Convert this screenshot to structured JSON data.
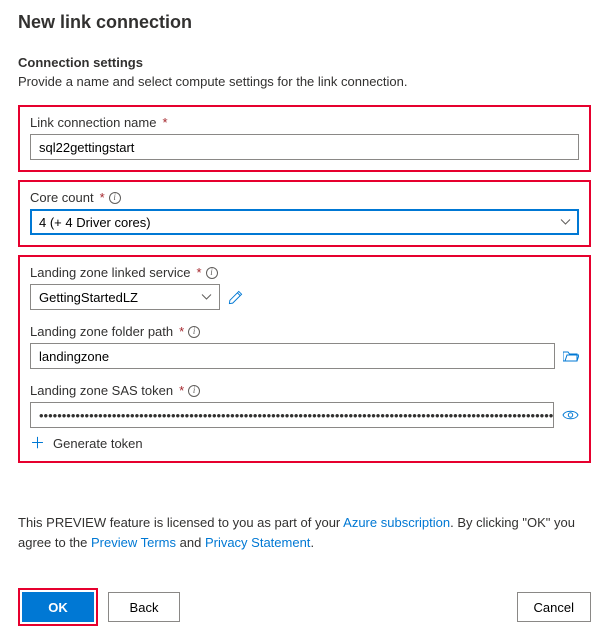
{
  "header": {
    "title": "New link connection",
    "section_title": "Connection settings",
    "subtitle": "Provide a name and select compute settings for the link connection."
  },
  "fields": {
    "link_name": {
      "label": "Link connection name",
      "value": "sql22gettingstart"
    },
    "core_count": {
      "label": "Core count",
      "value": "4 (+ 4 Driver cores)"
    },
    "lz_service": {
      "label": "Landing zone linked service",
      "value": "GettingStartedLZ"
    },
    "lz_folder": {
      "label": "Landing zone folder path",
      "value": "landingzone"
    },
    "lz_sas": {
      "label": "Landing zone SAS token",
      "value_mask": "•••••••••••••••••••••••••••••••••••••••••••••••••••••••••••••••••••••••••••••••••••••••••••••••••••••••••••••••••••••••••••••••••••••••••••••••••…"
    },
    "generate_token": "Generate token"
  },
  "preview": {
    "part1": "This PREVIEW feature is licensed to you as part of your ",
    "link1": "Azure subscription",
    "part2": ". By clicking \"OK\" you agree to the ",
    "link2": "Preview Terms",
    "part3": " and ",
    "link3": "Privacy Statement",
    "part4": "."
  },
  "footer": {
    "ok": "OK",
    "back": "Back",
    "cancel": "Cancel"
  }
}
